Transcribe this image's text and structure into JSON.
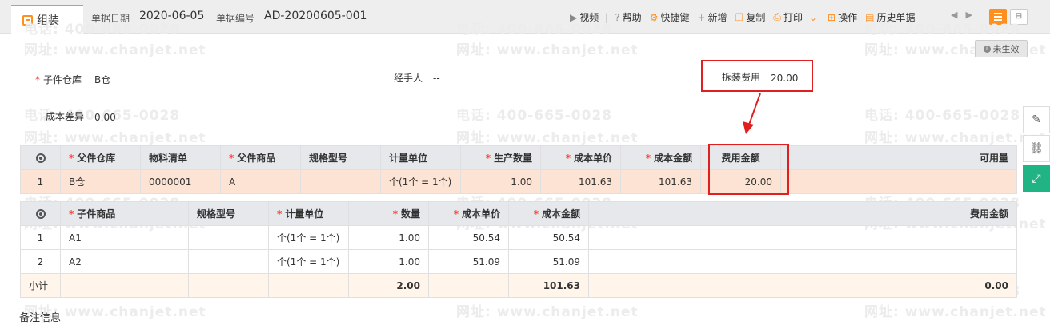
{
  "tab": {
    "label": "组装"
  },
  "header": {
    "date_label": "单据日期",
    "date_value": "2020-06-05",
    "code_label": "单据编号",
    "code_value": "AD-20200605-001"
  },
  "toolbar": {
    "video": "视频",
    "help": "帮助",
    "shortcut": "快捷键",
    "new": "新增",
    "copy": "复制",
    "print": "打印",
    "operate": "操作",
    "history": "历史单据"
  },
  "status": "未生效",
  "form": {
    "child_warehouse_label": "子件仓库",
    "child_warehouse_value": "B仓",
    "handler_label": "经手人",
    "handler_value": "--",
    "fee_label": "拆装费用",
    "fee_value": "20.00",
    "cost_diff_label": "成本差异",
    "cost_diff_value": "0.00"
  },
  "watermark": {
    "phone": "电话: 400-665-0028",
    "site": "网址: www.chanjet.net"
  },
  "parent_table": {
    "headers": [
      "父件仓库",
      "物料清单",
      "父件商品",
      "规格型号",
      "计量单位",
      "生产数量",
      "成本单价",
      "成本金额",
      "费用金额",
      "可用量"
    ],
    "row": {
      "no": "1",
      "warehouse": "B仓",
      "bom": "0000001",
      "product": "A",
      "spec": "",
      "unit": "个(1个 = 1个)",
      "qty": "1.00",
      "price": "101.63",
      "amount": "101.63",
      "fee": "20.00",
      "available": ""
    }
  },
  "child_table": {
    "headers": [
      "子件商品",
      "规格型号",
      "计量单位",
      "数量",
      "成本单价",
      "成本金额",
      "费用金额"
    ],
    "rows": [
      {
        "no": "1",
        "product": "A1",
        "spec": "",
        "unit": "个(1个 = 1个)",
        "qty": "1.00",
        "price": "50.54",
        "amount": "50.54",
        "fee": ""
      },
      {
        "no": "2",
        "product": "A2",
        "spec": "",
        "unit": "个(1个 = 1个)",
        "qty": "1.00",
        "price": "51.09",
        "amount": "51.09",
        "fee": ""
      }
    ],
    "subtotal": {
      "label": "小计",
      "qty": "2.00",
      "amount": "101.63",
      "fee": "0.00"
    }
  },
  "remark_label": "备注信息",
  "colors": {
    "accent": "#ff8f1f",
    "highlight_box": "#e02020",
    "side_green": "#20b384"
  }
}
